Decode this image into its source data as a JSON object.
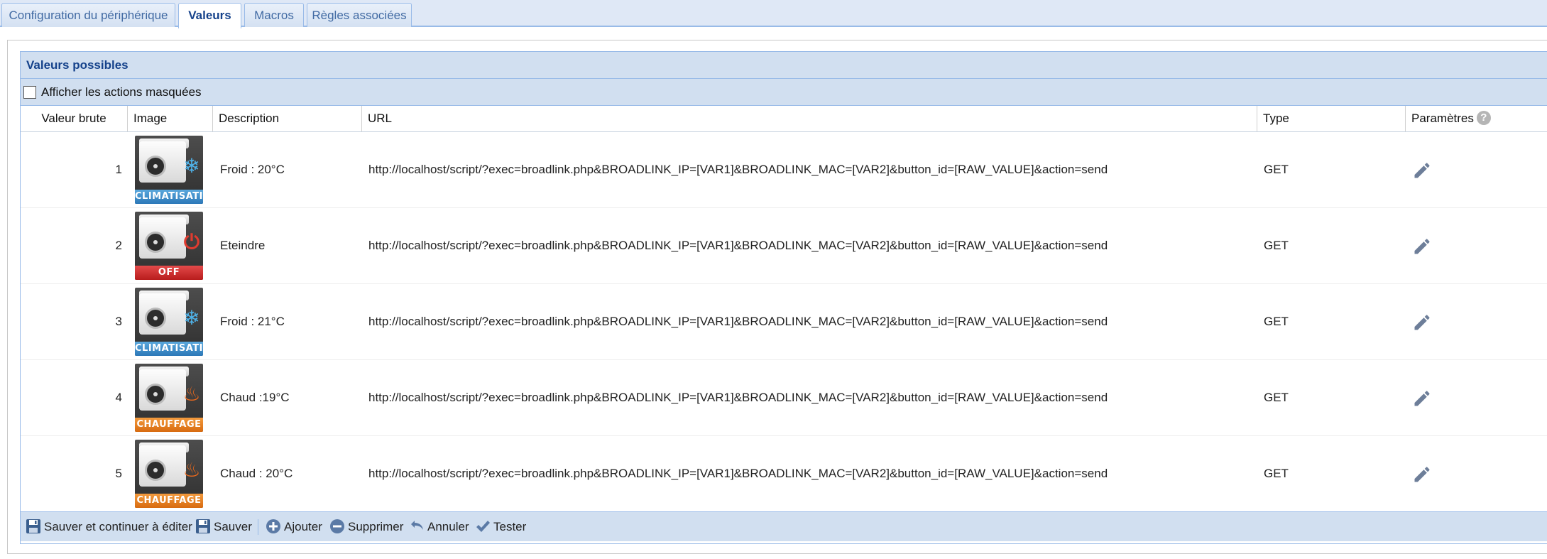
{
  "tabs": [
    {
      "label": "Configuration du périphérique",
      "active": false
    },
    {
      "label": "Valeurs",
      "active": true
    },
    {
      "label": "Macros",
      "active": false
    },
    {
      "label": "Règles associées",
      "active": false
    }
  ],
  "panel": {
    "title": "Valeurs possibles",
    "show_hidden_label": "Afficher les actions masquées",
    "show_hidden_checked": false
  },
  "columns": {
    "raw": "Valeur brute",
    "image": "Image",
    "description": "Description",
    "url": "URL",
    "type": "Type",
    "params": "Paramètres"
  },
  "rows": [
    {
      "raw": "1",
      "image_band": "CLIMATISATION",
      "image_mode": "snowflake-icon",
      "description": "Froid : 20°C",
      "url": "http://localhost/script/?exec=broadlink.php&BROADLINK_IP=[VAR1]&BROADLINK_MAC=[VAR2]&button_id=[RAW_VALUE]&action=send",
      "type": "GET"
    },
    {
      "raw": "2",
      "image_band": "OFF",
      "image_mode": "power-icon",
      "description": "Eteindre",
      "url": "http://localhost/script/?exec=broadlink.php&BROADLINK_IP=[VAR1]&BROADLINK_MAC=[VAR2]&button_id=[RAW_VALUE]&action=send",
      "type": "GET"
    },
    {
      "raw": "3",
      "image_band": "CLIMATISATION",
      "image_mode": "snowflake-icon",
      "description": "Froid : 21°C",
      "url": "http://localhost/script/?exec=broadlink.php&BROADLINK_IP=[VAR1]&BROADLINK_MAC=[VAR2]&button_id=[RAW_VALUE]&action=send",
      "type": "GET"
    },
    {
      "raw": "4",
      "image_band": "CHAUFFAGE",
      "image_mode": "flame-icon",
      "description": "Chaud :19°C",
      "url": "http://localhost/script/?exec=broadlink.php&BROADLINK_IP=[VAR1]&BROADLINK_MAC=[VAR2]&button_id=[RAW_VALUE]&action=send",
      "type": "GET"
    },
    {
      "raw": "5",
      "image_band": "CHAUFFAGE",
      "image_mode": "flame-icon",
      "description": "Chaud : 20°C",
      "url": "http://localhost/script/?exec=broadlink.php&BROADLINK_IP=[VAR1]&BROADLINK_MAC=[VAR2]&button_id=[RAW_VALUE]&action=send",
      "type": "GET"
    }
  ],
  "toolbar": {
    "save_continue": "Sauver et continuer à éditer",
    "save": "Sauver",
    "add": "Ajouter",
    "delete": "Supprimer",
    "undo": "Annuler",
    "test": "Tester"
  },
  "colors": {
    "accent": "#15428b",
    "header_bg": "#d1dff0",
    "border": "#99bbe8",
    "band_cool": "#2c78b8",
    "band_off": "#b81c1c",
    "band_heat": "#d86b10"
  }
}
